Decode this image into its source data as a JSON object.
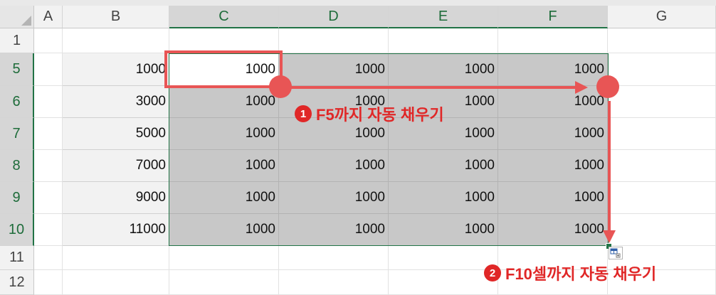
{
  "columns": [
    "A",
    "B",
    "C",
    "D",
    "E",
    "F",
    "G"
  ],
  "rows": [
    "1",
    "5",
    "6",
    "7",
    "8",
    "9",
    "10",
    "11",
    "12"
  ],
  "b_values": [
    "1000",
    "3000",
    "5000",
    "7000",
    "9000",
    "11000"
  ],
  "cell_value": "1000",
  "annotations": {
    "step1_badge": "1",
    "step1_text": "F5까지 자동 채우기",
    "step2_badge": "2",
    "step2_text": "F10셀까지 자동 채우기"
  },
  "colors": {
    "accent": "#217346",
    "annotation": "#e85555"
  }
}
